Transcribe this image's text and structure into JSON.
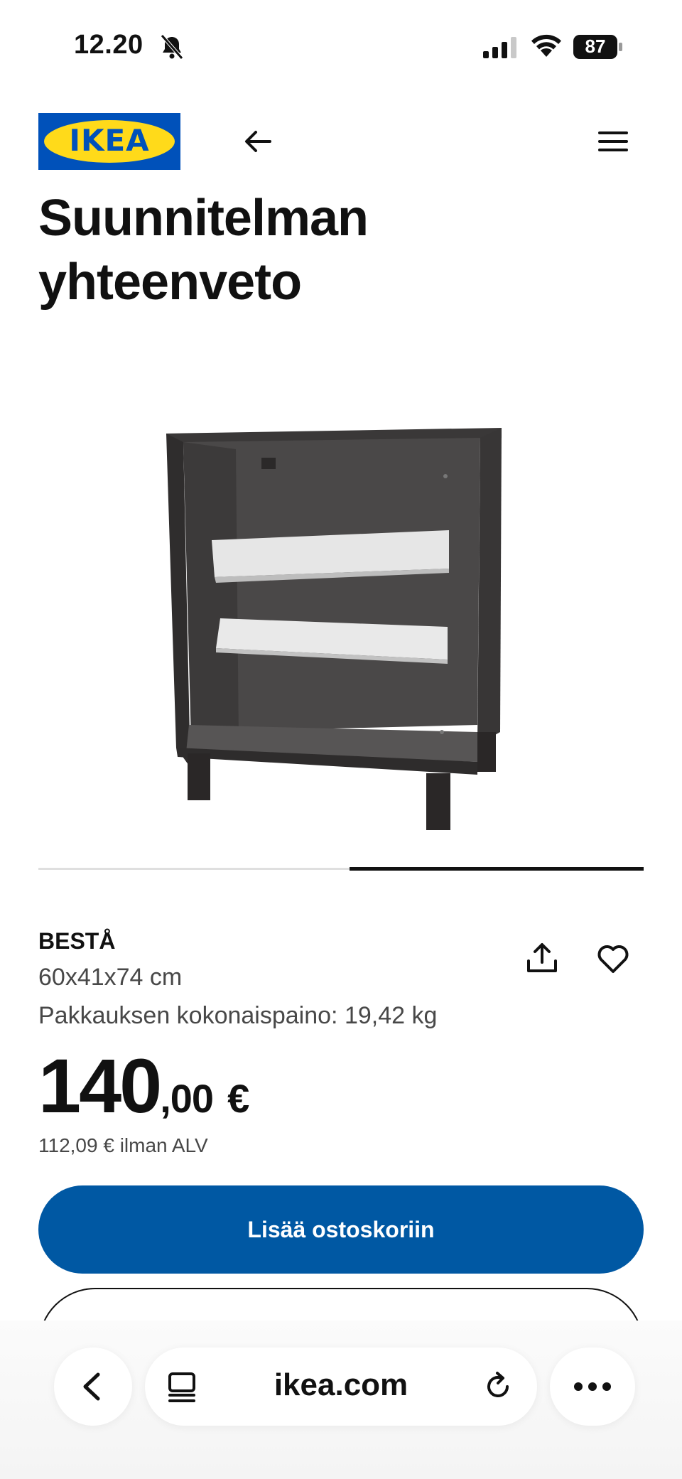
{
  "status_bar": {
    "time": "12.20",
    "battery": "87",
    "icons": [
      "bell-slash-icon",
      "signal-icon",
      "wifi-icon",
      "battery-icon"
    ]
  },
  "header": {
    "logo_text": "IKEA",
    "back_icon": "arrow-left-icon",
    "menu_icon": "hamburger-menu-icon"
  },
  "page": {
    "title": "Suunnitelman yhteenveto"
  },
  "carousel": {
    "active_index": 1,
    "count": 2
  },
  "product": {
    "name": "BESTÅ",
    "dimensions": "60x41x74 cm",
    "weight": "Pakkauksen kokonaispaino: 19,42 kg",
    "price_int": "140",
    "price_dec": ",00",
    "currency": "€",
    "price_excl_vat": "112,09 € ilman ALV",
    "share_icon": "share-icon",
    "favourite_icon": "heart-icon"
  },
  "actions": {
    "add_to_cart": "Lisää ostoskoriin"
  },
  "browser": {
    "url": "ikea.com",
    "icons": [
      "chevron-left-icon",
      "reader-icon",
      "reload-icon",
      "more-icon"
    ]
  },
  "colors": {
    "ikea_blue": "#0058a3",
    "logo_blue": "#0051ba",
    "logo_yellow": "#ffda1a"
  }
}
